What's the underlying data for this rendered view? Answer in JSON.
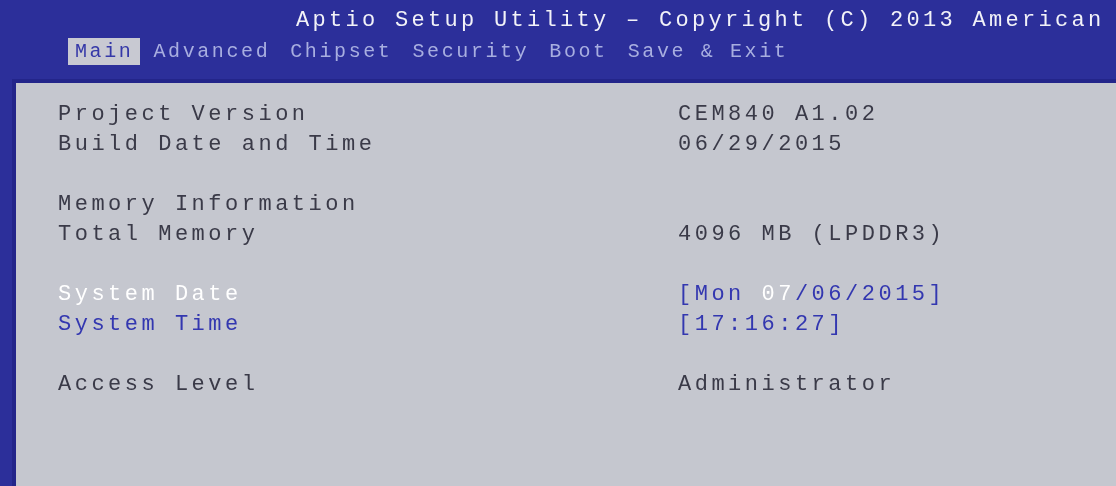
{
  "window": {
    "title": "Aptio Setup Utility – Copyright (C) 2013 American"
  },
  "tabs": [
    {
      "label": "Main",
      "selected": true
    },
    {
      "label": "Advanced",
      "selected": false
    },
    {
      "label": "Chipset",
      "selected": false
    },
    {
      "label": "Security",
      "selected": false
    },
    {
      "label": "Boot",
      "selected": false
    },
    {
      "label": "Save & Exit",
      "selected": false
    }
  ],
  "groups": [
    {
      "rows": [
        {
          "kind": "info",
          "label": "Project Version",
          "value": "CEM840 A1.02"
        },
        {
          "kind": "info",
          "label": "Build Date and Time",
          "value": "06/29/2015"
        }
      ]
    },
    {
      "rows": [
        {
          "kind": "heading",
          "label": "Memory Information"
        },
        {
          "kind": "info",
          "label": "Total Memory",
          "value": "4096 MB (LPDDR3)"
        }
      ]
    },
    {
      "rows": [
        {
          "kind": "setting",
          "label": "System Date",
          "selected": true,
          "value_parts": [
            {
              "text": "[Mon ",
              "selected": false
            },
            {
              "text": "07",
              "selected": true
            },
            {
              "text": "/06/2015]",
              "selected": false
            }
          ]
        },
        {
          "kind": "setting",
          "label": "System Time",
          "selected": false,
          "value_parts": [
            {
              "text": "[17:16:27]",
              "selected": false
            }
          ]
        }
      ]
    },
    {
      "rows": [
        {
          "kind": "info",
          "label": "Access Level",
          "value": "Administrator"
        }
      ]
    }
  ]
}
